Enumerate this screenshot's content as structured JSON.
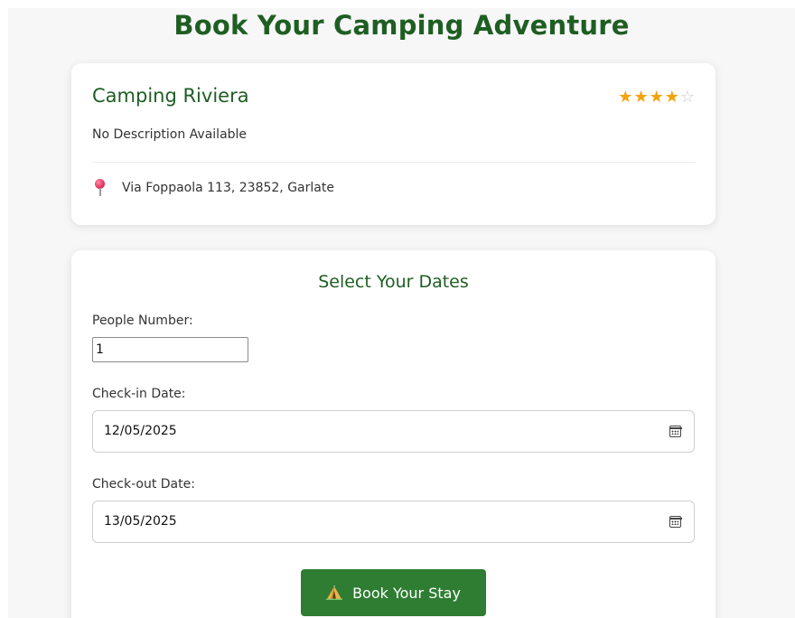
{
  "page": {
    "title": "Book Your Camping Adventure"
  },
  "campsite": {
    "name": "Camping Riviera",
    "rating": 4,
    "rating_max": 5,
    "rating_text": "★★★★☆",
    "description": "No Description Available",
    "address": "Via Foppaola 113, 23852, Garlate",
    "address_icon": "pin-icon"
  },
  "booking": {
    "section_title": "Select Your Dates",
    "people_label": "People Number:",
    "people_value": "1",
    "checkin_label": "Check-in Date:",
    "checkin_value": "12/05/2025",
    "checkout_label": "Check-out Date:",
    "checkout_value": "13/05/2025",
    "date_icon": "calendar-icon",
    "submit_label": "Book Your Stay",
    "submit_icon": "tent-icon"
  },
  "colors": {
    "primary_green": "#1f5e23",
    "button_green": "#2e7d32",
    "star_filled": "#f4a20a",
    "star_empty": "#c9c9c9"
  }
}
